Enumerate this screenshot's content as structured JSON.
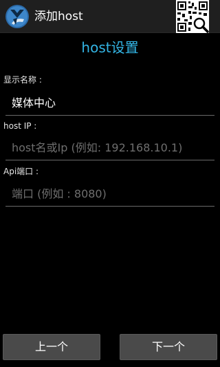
{
  "app_bar": {
    "title": "添加host",
    "app_icon": "app-logo-icon",
    "qr_icon": "qr-code-scan-icon"
  },
  "section_title": "host设置",
  "fields": {
    "display_name": {
      "label": "显示名称 :",
      "value": "媒体中心"
    },
    "host_ip": {
      "label": "host IP :",
      "placeholder": "host名或Ip (例如: 192.168.10.1)"
    },
    "api_port": {
      "label": "Api端口 :",
      "placeholder": "端口 (例如 : 8080)"
    }
  },
  "buttons": {
    "prev": "上一个",
    "next": "下一个"
  },
  "colors": {
    "accent": "#33b5e5",
    "background": "#000000",
    "button": "#4a4a4a"
  }
}
